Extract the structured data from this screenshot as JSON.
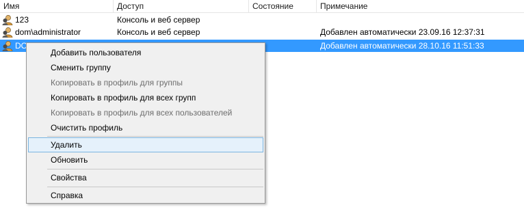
{
  "columns": [
    "Имя",
    "Доступ",
    "Состояние",
    "Примечание"
  ],
  "rows": [
    {
      "name": "123",
      "access": "Консоль и веб сервер",
      "state": "",
      "note": ""
    },
    {
      "name": "dom\\administrator",
      "access": "Консоль и веб сервер",
      "state": "",
      "note": "Добавлен автоматически 23.09.16 12:37:31"
    },
    {
      "name": "DO",
      "access": "",
      "state": "",
      "note": "Добавлен автоматически 28.10.16 11:51:33"
    }
  ],
  "menu": {
    "add_user": "Добавить пользователя",
    "change_group": "Сменить группу",
    "copy_group": "Копировать в профиль для группы",
    "copy_all_groups": "Копировать в профиль для всех групп",
    "copy_all_users": "Копировать в профиль для всех пользователей",
    "clear_profile": "Очистить профиль",
    "delete": "Удалить",
    "refresh": "Обновить",
    "properties": "Свойства",
    "help": "Справка"
  },
  "colors": {
    "selection": "#3399ff",
    "menu_hover": "#e5f1fb",
    "menu_bg": "#f0f0f0"
  },
  "icons": {
    "user": "user-icon"
  }
}
